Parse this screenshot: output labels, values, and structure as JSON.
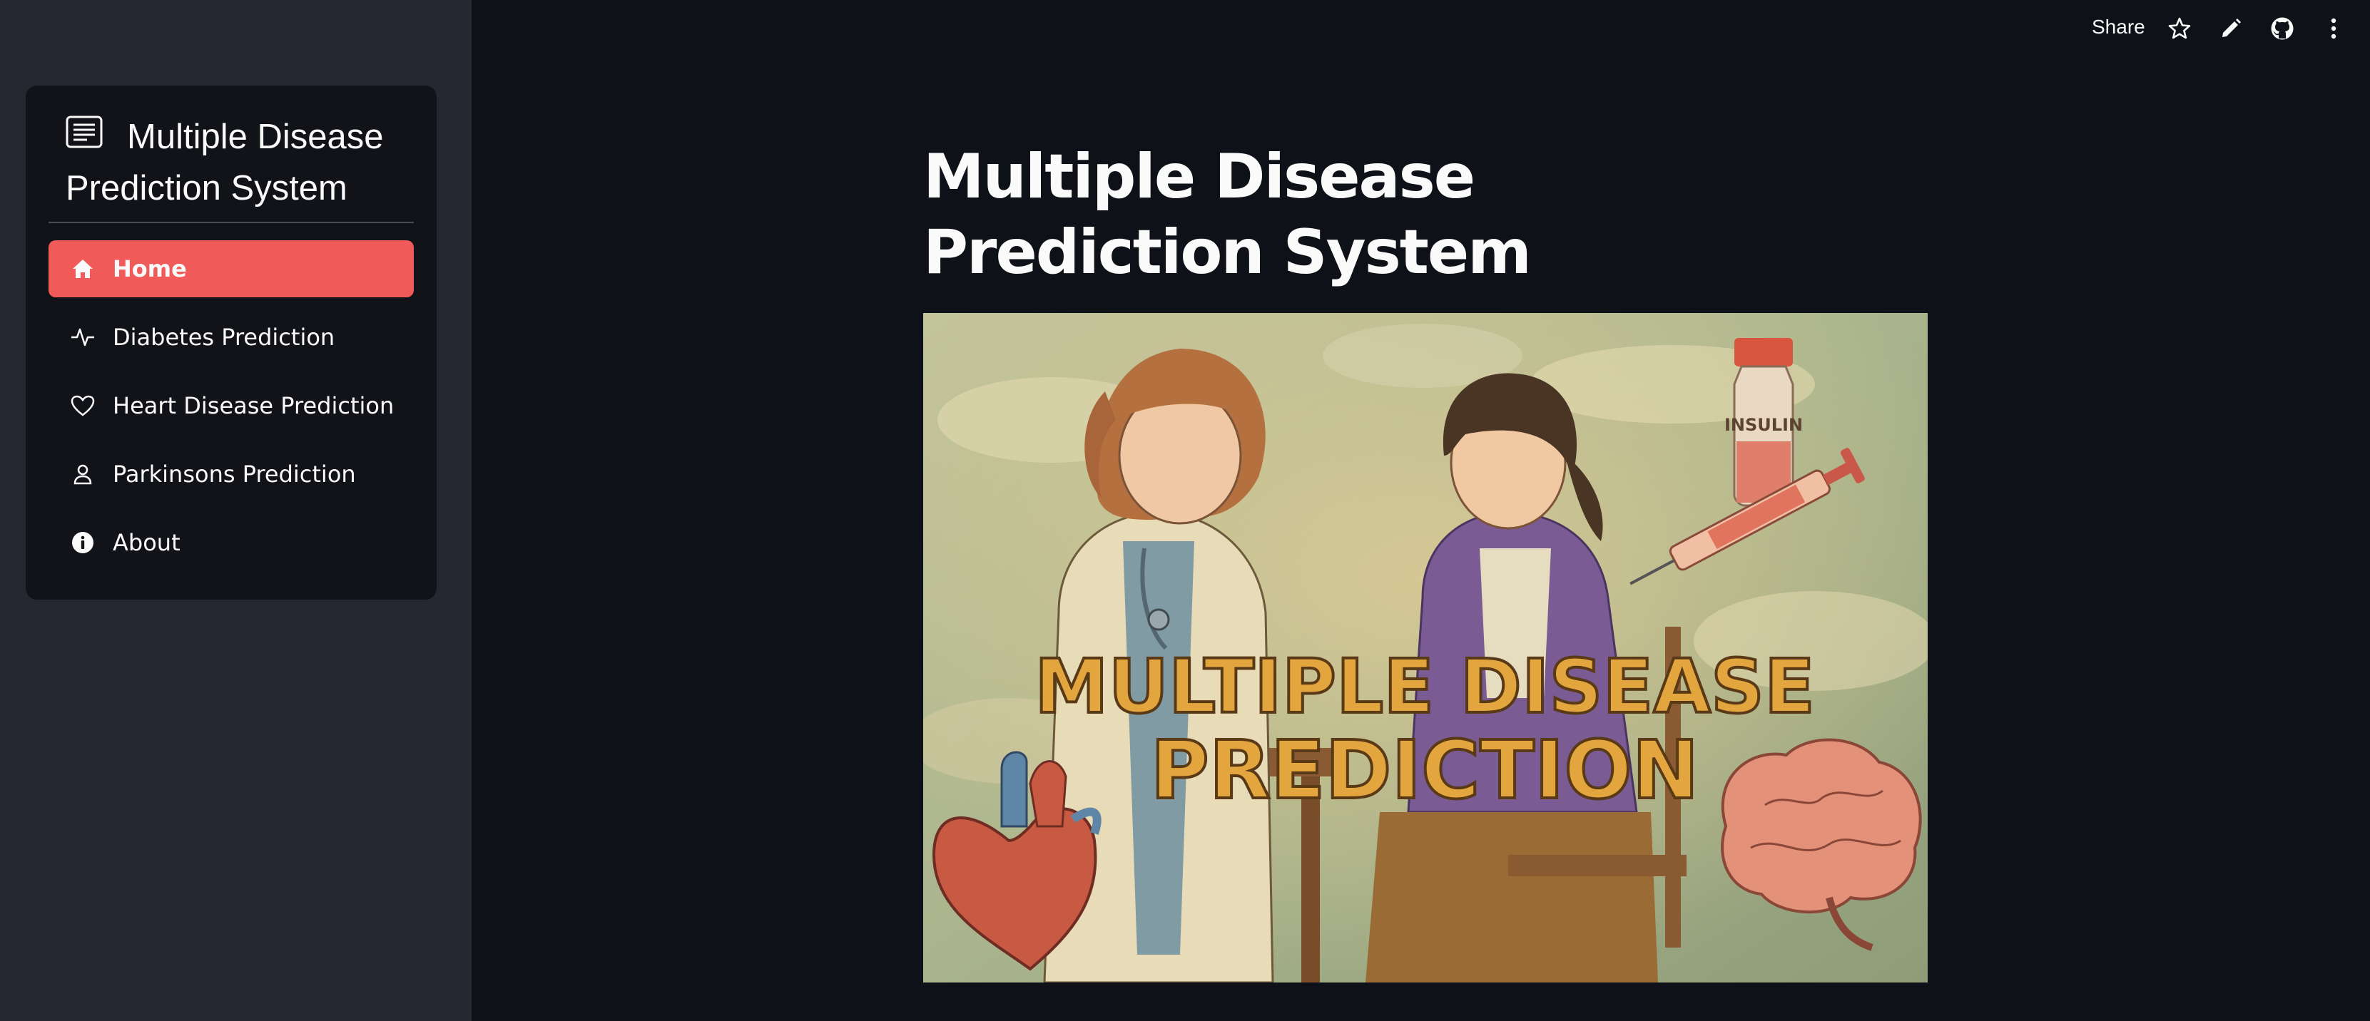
{
  "sidebar": {
    "menu_title": "Multiple Disease Prediction System",
    "menu_icon": "card-text-icon",
    "items": [
      {
        "label": "Home",
        "icon": "house-icon",
        "active": true
      },
      {
        "label": "Diabetes Prediction",
        "icon": "activity-icon",
        "active": false
      },
      {
        "label": "Heart Disease Prediction",
        "icon": "heart-icon",
        "active": false
      },
      {
        "label": "Parkinsons Prediction",
        "icon": "person-icon",
        "active": false
      },
      {
        "label": "About",
        "icon": "info-circle-icon",
        "active": false
      }
    ]
  },
  "toolbar": {
    "share_label": "Share",
    "icons": [
      "star-icon",
      "pencil-icon",
      "github-icon",
      "more-vertical-icon"
    ]
  },
  "main": {
    "title": "Multiple Disease Prediction System",
    "hero_image": {
      "text_line1": "MULTIPLE DISEASE",
      "text_line2": "PREDICTION",
      "bottle_label": "INSULIN"
    }
  },
  "colors": {
    "accent": "#f05a59",
    "sidebar_bg": "#262730",
    "nav_card_bg": "#111318",
    "main_bg": "#0e1117",
    "text": "#fafafa"
  }
}
